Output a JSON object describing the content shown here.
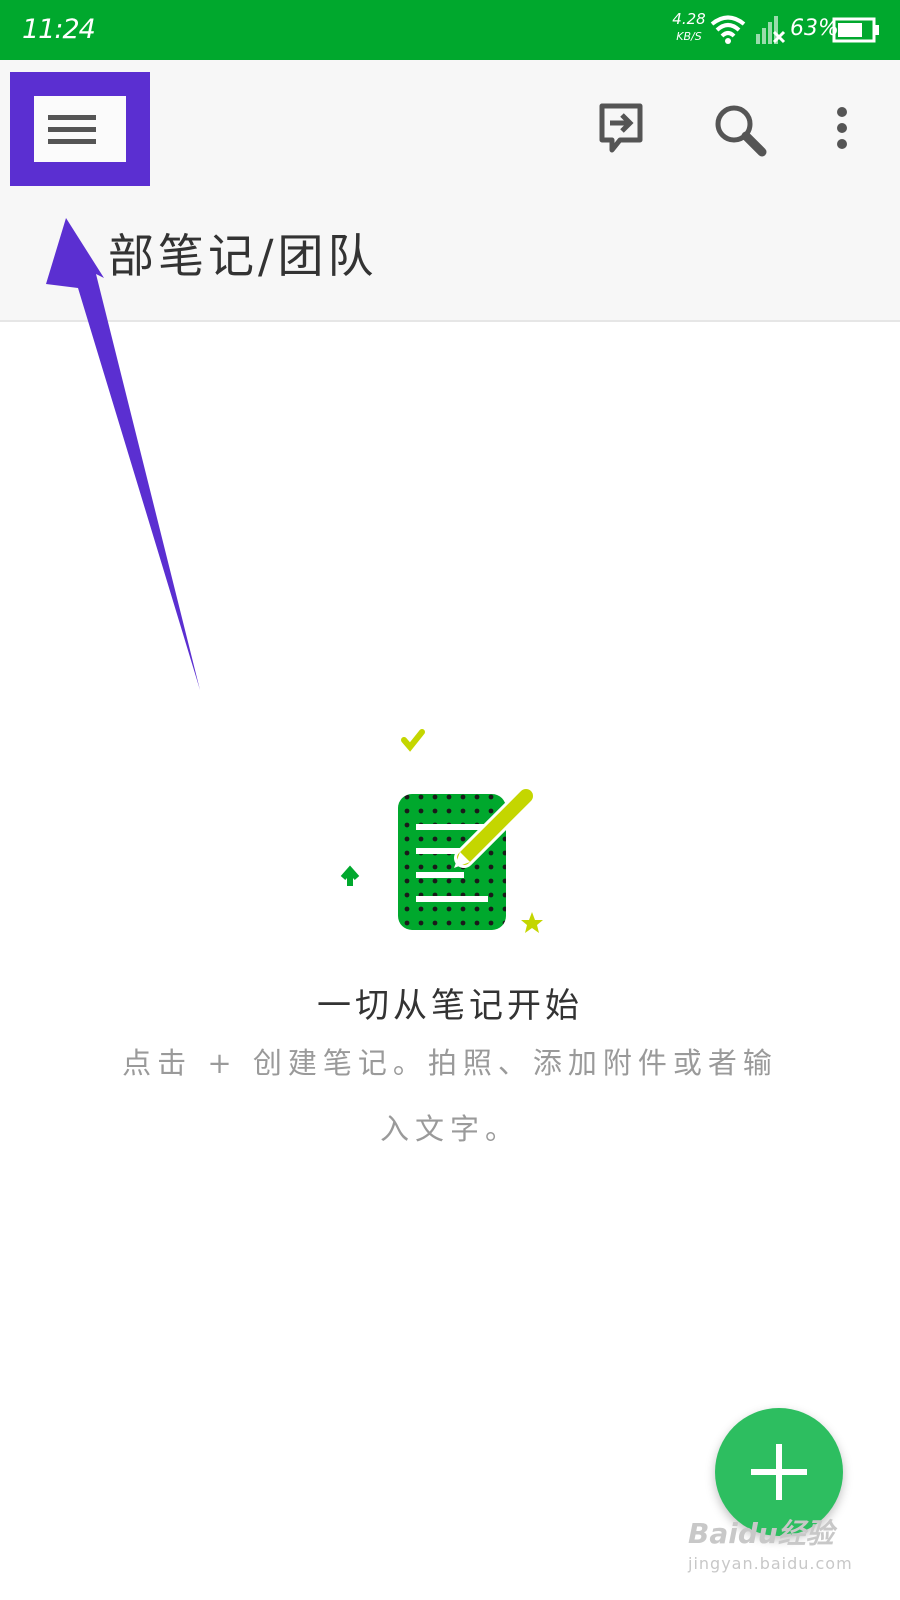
{
  "status_bar": {
    "time": "11:24",
    "net_speed_value": "4.28",
    "net_speed_unit": "KB/S",
    "battery_percent": "63%"
  },
  "toolbar": {
    "menu_icon": "hamburger-menu-icon",
    "sync_icon": "switch-account-icon",
    "search_icon": "search-icon",
    "more_icon": "more-vertical-icon"
  },
  "header": {
    "title": "部笔记/团队"
  },
  "empty_state": {
    "title": "一切从笔记开始",
    "description": "点击 + 创建笔记。拍照、添加附件或者输入文字。"
  },
  "fab": {
    "icon": "plus-icon"
  },
  "watermark": {
    "brand": "Baidu经验",
    "url": "jingyan.baidu.com"
  },
  "colors": {
    "status_bar": "#00a82d",
    "accent": "#2dbe60",
    "annotation": "#5b2fd1"
  }
}
